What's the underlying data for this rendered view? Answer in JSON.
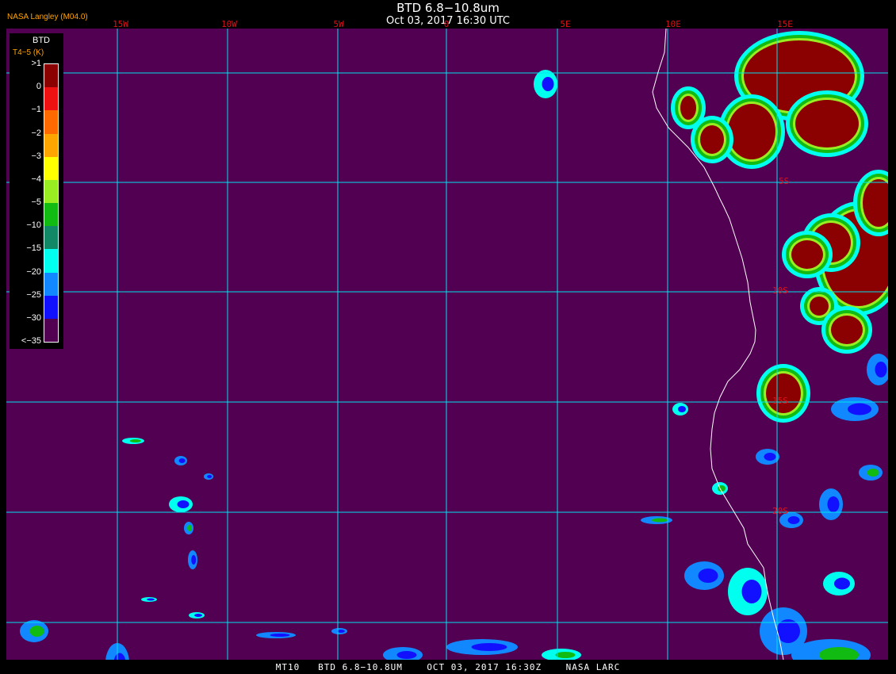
{
  "header": {
    "credit": "NASA Langley (M04.0)",
    "title": "BTD 6.8−10.8um",
    "subtitle": "Oct 03, 2017 16:30 UTC"
  },
  "legend": {
    "title": "BTD",
    "subtitle": "T4−5 (K)",
    "ticks": [
      ">1",
      "0",
      "−1",
      "−2",
      "−3",
      "−4",
      "−5",
      "−10",
      "−15",
      "−20",
      "−25",
      "−30",
      "<−35"
    ],
    "colors": [
      "#8b0000",
      "#ee1111",
      "#ff6a00",
      "#ffa500",
      "#ffff00",
      "#99ee22",
      "#11bb11",
      "#118866",
      "#00ffee",
      "#1188ff",
      "#1111ff",
      "#520052"
    ]
  },
  "map": {
    "background_color": "#520052",
    "grid_color": "#00e5ee",
    "coast_color": "#ffffff",
    "lon_labels": [
      "15W",
      "10W",
      "5W",
      "0",
      "5E",
      "10E",
      "15E"
    ],
    "lat_labels": [
      "5S",
      "10S",
      "15S",
      "20S"
    ]
  },
  "footer": {
    "text": "MT10   BTD 6.8−10.8UM    OCT 03, 2017 16:30Z    NASA LARC"
  }
}
